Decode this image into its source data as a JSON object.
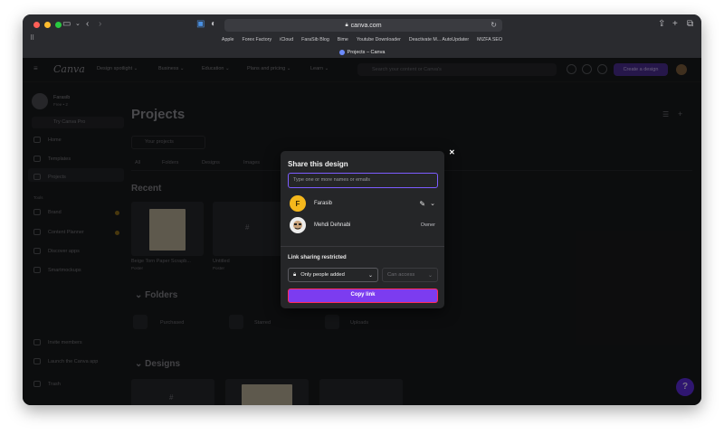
{
  "browser": {
    "url": "canva.com",
    "favorites": [
      "Apple",
      "Forex Factory",
      "iCloud",
      "FaraSib Blog",
      "Bime",
      "Youtube Downloader",
      "Deactivate M... AutoUpdater",
      "MIZFA SEO"
    ],
    "tab_title": "Projects – Canva"
  },
  "app": {
    "logo": "Canva",
    "nav": [
      "Design spotlight ⌄",
      "Business ⌄",
      "Education ⌄",
      "Plans and pricing ⌄",
      "Learn ⌄"
    ],
    "search_placeholder": "Search your content or Canva's",
    "create_button": "Create a design",
    "user_name": "Farasib",
    "user_sub": "Free • 2",
    "try_pro": "Try Canva Pro",
    "sidebar": [
      "Home",
      "Templates",
      "Projects",
      "Brand",
      "Content Planner",
      "Discover apps",
      "Smartmockups"
    ],
    "sidebar_section": "Tools",
    "sidebar_bottom": [
      "Invite members",
      "Launch the Canva app",
      "Trash"
    ],
    "page_title": "Projects",
    "filter": "Your projects",
    "tabs": [
      "All",
      "Folders",
      "Designs",
      "Images"
    ],
    "section_recent": "Recent",
    "recent_items": [
      "Beige Torn Paper Scrapb...",
      "Untitled"
    ],
    "recent_sub": [
      "Poster",
      "Poster"
    ],
    "section_folders": "Folders",
    "folders": [
      "Purchased",
      "Starred",
      "Uploads"
    ],
    "section_designs": "Designs"
  },
  "share": {
    "title": "Share this design",
    "input_placeholder": "Type one or more names or emails",
    "people": [
      {
        "initial": "F",
        "name": "Farasib",
        "role": "",
        "avatar_color": "#f5b81c"
      },
      {
        "initial": "",
        "name": "Mehdi Dehnabi",
        "role": "Owner",
        "avatar_color": "#ececec"
      }
    ],
    "link_label": "Link sharing restricted",
    "access_select": "Only people added",
    "permission_select": "Can access",
    "copy_button": "Copy link"
  },
  "colors": {
    "accent": "#7c3cf0",
    "highlight": "#ff2a5a",
    "focus": "#7c5cff"
  }
}
